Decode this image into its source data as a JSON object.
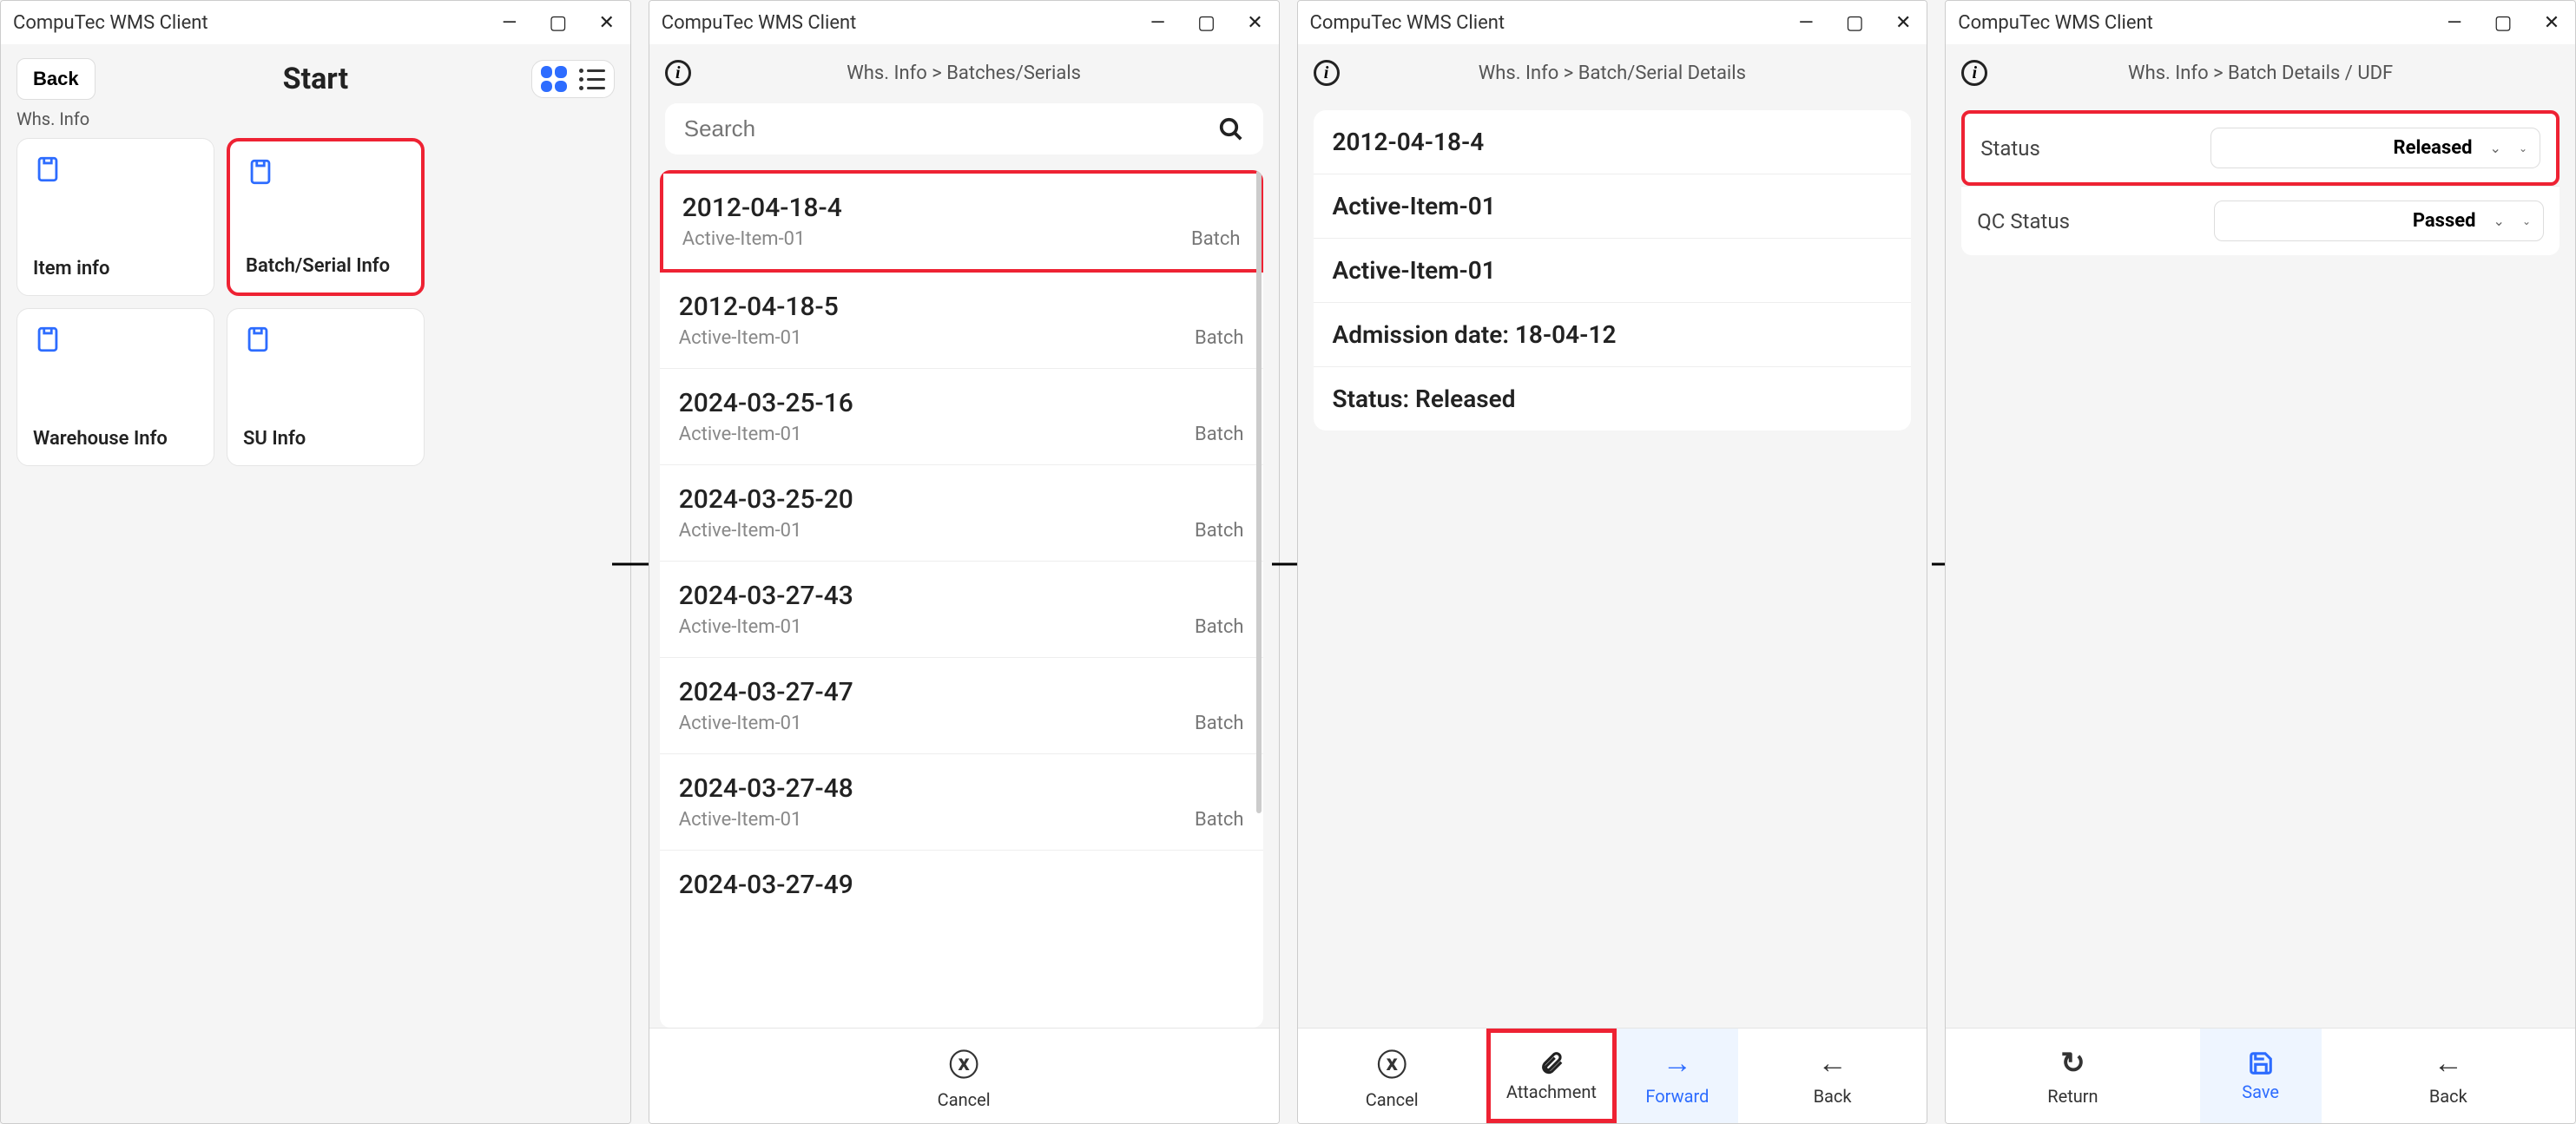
{
  "app_title": "CompuTec WMS Client",
  "screen1": {
    "back": "Back",
    "title": "Start",
    "section": "Whs. Info",
    "tiles": [
      {
        "label": "Item info"
      },
      {
        "label": "Batch/Serial Info",
        "highlight": true
      },
      {
        "label": "Warehouse Info"
      },
      {
        "label": "SU Info"
      }
    ]
  },
  "screen2": {
    "breadcrumb": "Whs. Info > Batches/Serials",
    "search_placeholder": "Search",
    "items": [
      {
        "id": "2012-04-18-4",
        "sub": "Active-Item-01",
        "tag": "Batch",
        "highlight": true
      },
      {
        "id": "2012-04-18-5",
        "sub": "Active-Item-01",
        "tag": "Batch"
      },
      {
        "id": "2024-03-25-16",
        "sub": "Active-Item-01",
        "tag": "Batch"
      },
      {
        "id": "2024-03-25-20",
        "sub": "Active-Item-01",
        "tag": "Batch"
      },
      {
        "id": "2024-03-27-43",
        "sub": "Active-Item-01",
        "tag": "Batch"
      },
      {
        "id": "2024-03-27-47",
        "sub": "Active-Item-01",
        "tag": "Batch"
      },
      {
        "id": "2024-03-27-48",
        "sub": "Active-Item-01",
        "tag": "Batch"
      },
      {
        "id": "2024-03-27-49",
        "sub": "",
        "tag": ""
      }
    ],
    "footer_cancel": "Cancel"
  },
  "screen3": {
    "breadcrumb": "Whs. Info > Batch/Serial Details",
    "rows": [
      "2012-04-18-4",
      "Active-Item-01",
      "Active-Item-01",
      "Admission date: 18-04-12",
      "Status: Released"
    ],
    "footer": {
      "cancel": "Cancel",
      "attachment": "Attachment",
      "forward": "Forward",
      "back": "Back"
    }
  },
  "screen4": {
    "breadcrumb": "Whs. Info > Batch Details / UDF",
    "fields": [
      {
        "label": "Status",
        "value": "Released",
        "highlight": true
      },
      {
        "label": "QC Status",
        "value": "Passed"
      }
    ],
    "footer": {
      "return": "Return",
      "save": "Save",
      "back": "Back"
    }
  }
}
